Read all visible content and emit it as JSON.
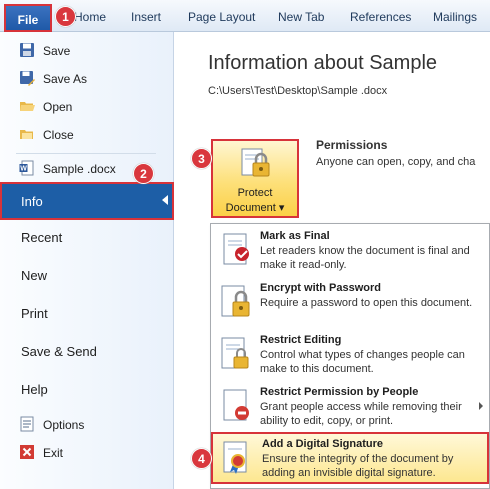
{
  "ribbon": {
    "file_tab": "File",
    "tabs": [
      "Home",
      "Insert",
      "Page Layout",
      "New Tab",
      "References",
      "Mailings"
    ]
  },
  "nav": {
    "commands": [
      {
        "label": "Save",
        "icon": "save-icon"
      },
      {
        "label": "Save As",
        "icon": "save-as-icon"
      },
      {
        "label": "Open",
        "icon": "open-folder-icon"
      },
      {
        "label": "Close",
        "icon": "close-document-icon"
      },
      {
        "label": "Sample .docx",
        "icon": "word-document-icon"
      }
    ],
    "info": "Info",
    "big_items": [
      "Recent",
      "New",
      "Print",
      "Save & Send",
      "Help"
    ],
    "bottom": [
      {
        "label": "Options",
        "icon": "options-icon"
      },
      {
        "label": "Exit",
        "icon": "exit-icon"
      }
    ]
  },
  "main": {
    "title": "Information about Sample",
    "path": "C:\\Users\\Test\\Desktop\\Sample .docx",
    "protect_button": {
      "line1": "Protect",
      "line2": "Document ▾"
    },
    "permissions": {
      "title": "Permissions",
      "description": "Anyone can open, copy, and cha"
    }
  },
  "menu": {
    "items": [
      {
        "title": "Mark as Final",
        "description": "Let readers know the document is final and make it read-only.",
        "icon": "mark-final-icon"
      },
      {
        "title": "Encrypt with Password",
        "description": "Require a password to open this document.",
        "icon": "encrypt-lock-icon"
      },
      {
        "title": "Restrict Editing",
        "description": "Control what types of changes people can make to this document.",
        "icon": "restrict-editing-icon"
      },
      {
        "title": "Restrict Permission by People",
        "description": "Grant people access while removing their ability to edit, copy, or print.",
        "icon": "restrict-permission-icon"
      },
      {
        "title": "Add a Digital Signature",
        "description": "Ensure the integrity of the document by adding an invisible digital signature.",
        "icon": "digital-signature-icon"
      }
    ]
  },
  "badges": [
    "1",
    "2",
    "3",
    "4"
  ],
  "colors": {
    "accent": "#1d5ea6",
    "highlight": "#fde07a",
    "callout": "#d7333a"
  }
}
